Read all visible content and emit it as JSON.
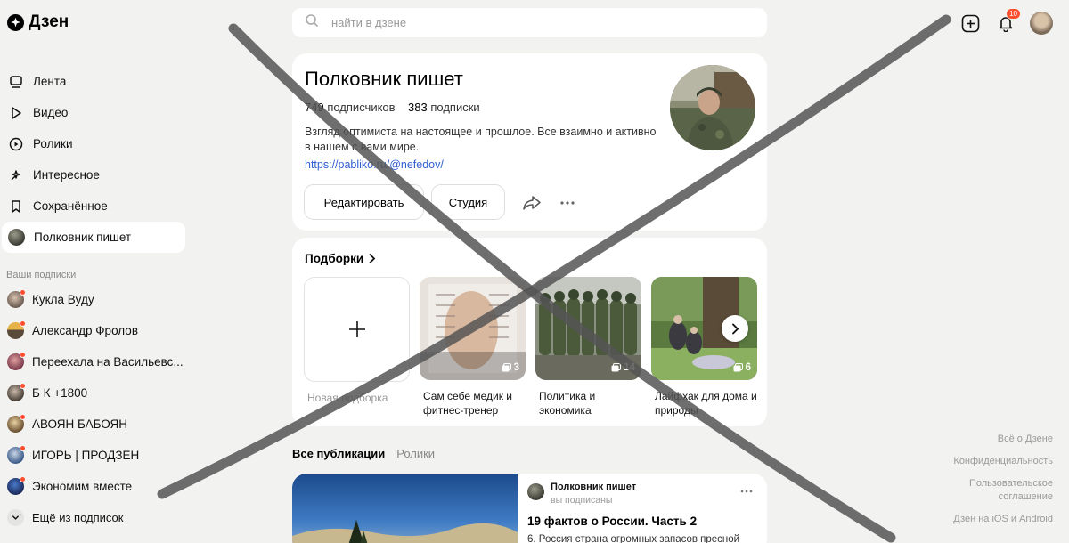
{
  "app": {
    "logo_text": "Дзен"
  },
  "search": {
    "placeholder": "найти в дзене"
  },
  "topbar": {
    "notifications_count": "10"
  },
  "sidebar": {
    "items": [
      {
        "label": "Лента",
        "icon": "feed-icon"
      },
      {
        "label": "Видео",
        "icon": "play-icon"
      },
      {
        "label": "Ролики",
        "icon": "clips-icon"
      },
      {
        "label": "Интересное",
        "icon": "interesting-icon"
      },
      {
        "label": "Сохранённое",
        "icon": "bookmark-icon"
      },
      {
        "label": "Полковник пишет",
        "icon": "channel-avatar",
        "active": true
      }
    ],
    "subscriptions_heading": "Ваши подписки",
    "subscriptions": [
      {
        "label": "Кукла Вуду"
      },
      {
        "label": "Александр Фролов"
      },
      {
        "label": "Переехала на Васильевс..."
      },
      {
        "label": "Б К +1800"
      },
      {
        "label": "АВОЯН БАБОЯН"
      },
      {
        "label": "ИГОРЬ | ПРОДЗЕН"
      },
      {
        "label": "Экономим вместе"
      }
    ],
    "more_label": "Ещё из подписок"
  },
  "profile": {
    "title": "Полковник пишет",
    "subscribers_count": "749",
    "subscribers_label": "подписчиков",
    "subscriptions_count": "383",
    "subscriptions_label": "подписки",
    "description": "Взгляд оптимиста на настоящее и прошлое. Все взаимно и активно в нашем с вами мире.",
    "link": "https://pabliko.ru/@nefedov/",
    "edit_label": "Редактировать",
    "studio_label": "Студия"
  },
  "collections": {
    "title": "Подборки",
    "new_label": "Новая подборка",
    "items": [
      {
        "label": "Сам себе медик и фитнес-тренер",
        "count": "3"
      },
      {
        "label": "Политика и экономика",
        "count": "14"
      },
      {
        "label": "Лайфхак для дома и природы",
        "count": "6"
      }
    ]
  },
  "tabs": {
    "all": "Все публикации",
    "clips": "Ролики"
  },
  "post": {
    "author": "Полковник пишет",
    "sub_status": "вы подписаны",
    "title": "19 фактов о России. Часть 2",
    "snippet": "6. Россия страна огромных запасов пресной"
  },
  "footer": {
    "about": "Всё о Дзене",
    "privacy": "Конфиденциальность",
    "agreement": "Пользовательское соглашение",
    "apps": "Дзен на iOS и Android"
  },
  "colors": {
    "link": "#2f5fd0",
    "badge": "#ff4d2e",
    "background": "#f2f2f1"
  }
}
